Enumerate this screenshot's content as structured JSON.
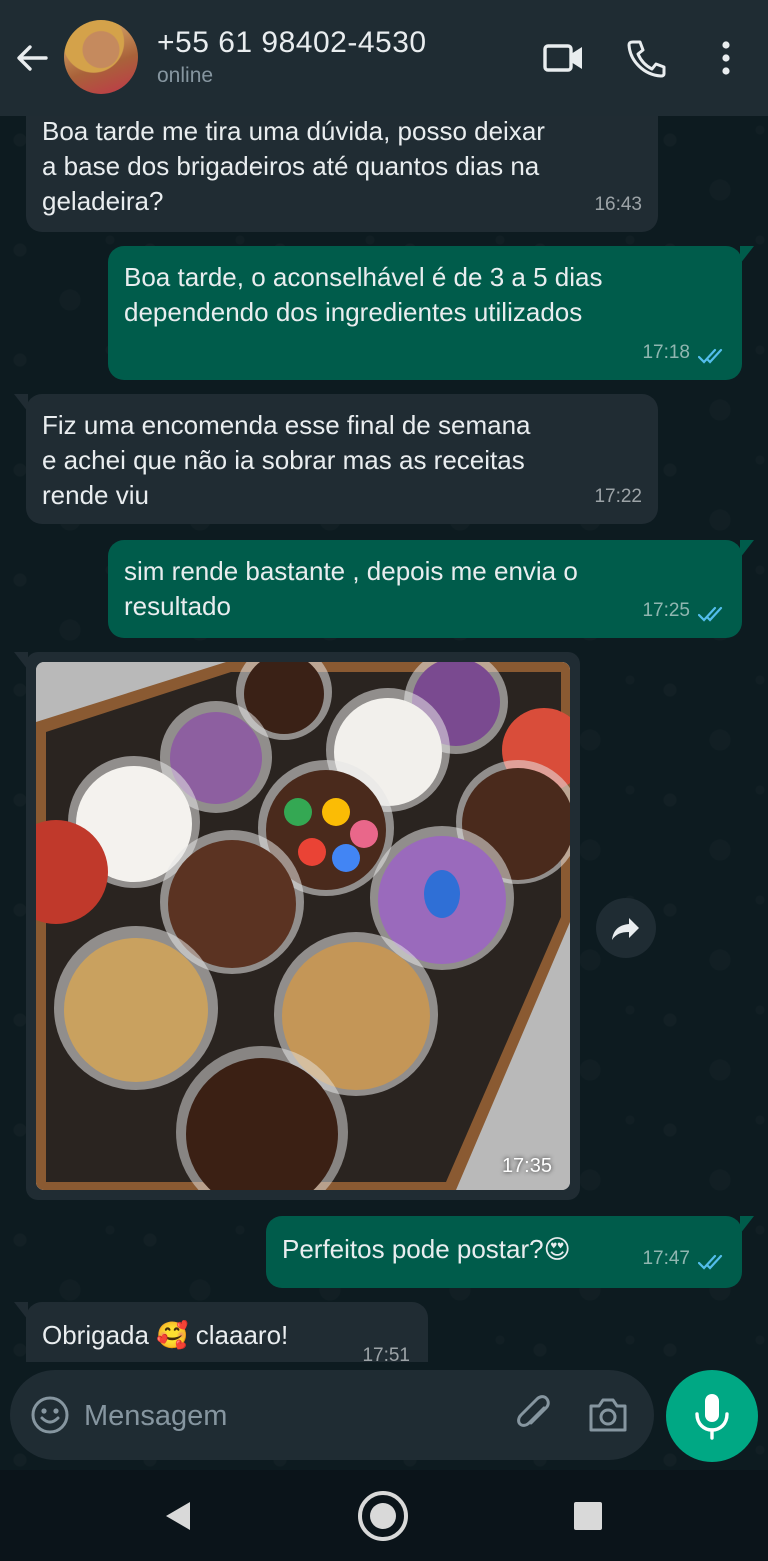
{
  "header": {
    "contact_name": "+55 61 98402-4530",
    "status": "online"
  },
  "messages": [
    {
      "direction": "in",
      "text": "Boa tarde me tira uma dúvida, posso deixar\na base dos brigadeiros até quantos dias na\ngeladeira?",
      "time": "16:43"
    },
    {
      "direction": "out",
      "text": "Boa tarde, o aconselhável é de 3 a 5 dias\ndependendo dos ingredientes utilizados",
      "time": "17:18",
      "read": true
    },
    {
      "direction": "in",
      "text": "Fiz uma encomenda esse final de semana\ne achei que não ia sobrar mas as receitas\nrende viu",
      "time": "17:22"
    },
    {
      "direction": "out",
      "text": "sim rende bastante , depois me envia o\nresultado",
      "time": "17:25",
      "read": true
    },
    {
      "direction": "in",
      "type": "image",
      "time": "17:35"
    },
    {
      "direction": "out",
      "text": "Perfeitos pode postar?😍",
      "time": "17:47",
      "read": true
    },
    {
      "direction": "in",
      "text": "Obrigada 🥰 claaaro!",
      "time": "17:51"
    }
  ],
  "composer": {
    "placeholder": "Mensagem"
  },
  "colors": {
    "header_bg": "#1f2c33",
    "incoming_bubble": "#202c33",
    "outgoing_bubble": "#005c4b",
    "read_ticks": "#53bdeb",
    "mic_button": "#00a884"
  },
  "icons": [
    "back-arrow-icon",
    "video-call-icon",
    "phone-icon",
    "more-vert-icon",
    "forward-icon",
    "emoji-icon",
    "attach-icon",
    "camera-icon",
    "mic-icon",
    "nav-back-icon",
    "nav-home-icon",
    "nav-recents-icon"
  ]
}
